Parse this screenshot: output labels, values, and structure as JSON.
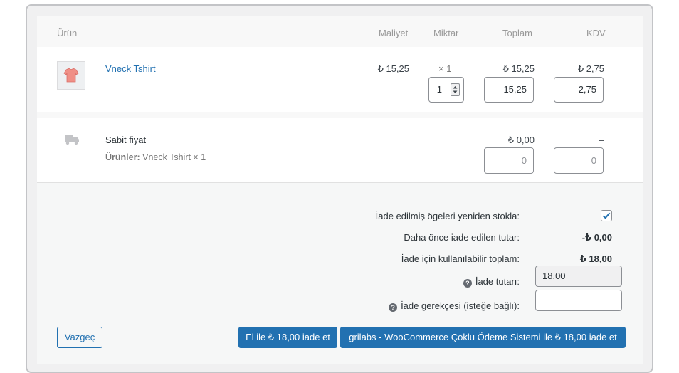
{
  "table": {
    "headers": {
      "product": "Ürün",
      "cost": "Maliyet",
      "qty": "Miktar",
      "total": "Toplam",
      "tax": "KDV"
    }
  },
  "item": {
    "name": "Vneck Tshirt",
    "cost": "₺ 15,25",
    "qty_text": "× 1",
    "qty_input": "1",
    "total": "₺ 15,25",
    "total_input": "15,25",
    "tax": "₺ 2,75",
    "tax_input": "2,75"
  },
  "shipping": {
    "name": "Sabit fiyat",
    "meta_label": "Ürünler:",
    "meta_value": "Vneck Tshirt × 1",
    "total": "₺ 0,00",
    "total_input": "0",
    "tax": "–",
    "tax_input": "0"
  },
  "refund": {
    "restock_label": "İade edilmiş ögeleri yeniden stokla:",
    "restock_checked": true,
    "already_label": "Daha önce iade edilen tutar:",
    "already_value": "-₺ 0,00",
    "available_label": "İade için kullanılabilir toplam:",
    "available_value": "₺ 18,00",
    "amount_label": "İade tutarı:",
    "amount_value": "18,00",
    "reason_label": "İade gerekçesi (isteğe bağlı):",
    "reason_value": "",
    "help_glyph": "?"
  },
  "actions": {
    "cancel": "Vazgeç",
    "manual": "El ile ₺ 18,00 iade et",
    "gateway": "grilabs - WooCommerce Çoklu Ödeme Sistemi ile ₺ 18,00 iade et"
  },
  "colors": {
    "accent": "#2271b1",
    "check": "#2271b1"
  }
}
